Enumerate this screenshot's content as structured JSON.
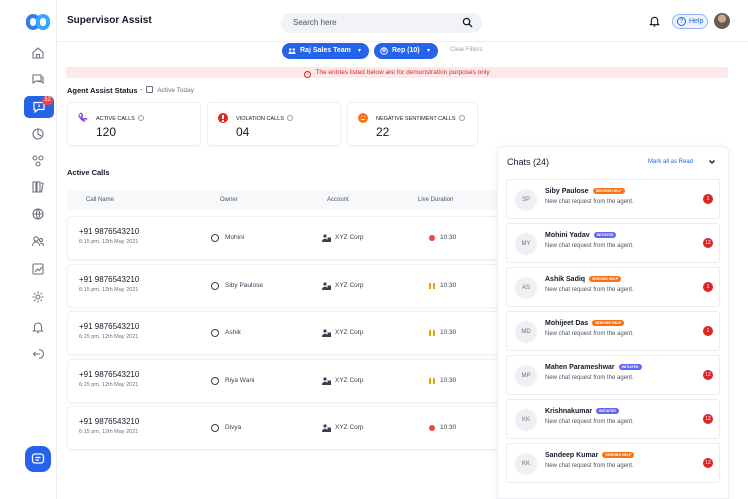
{
  "app": {
    "title": "Supervisor Assist"
  },
  "sidebar": {
    "badge": "32"
  },
  "search": {
    "placeholder": "Search here"
  },
  "header": {
    "help_label": "Help"
  },
  "filters": {
    "team": "Raj Sales Team",
    "rep": "Rep (10)",
    "clear": "Clear Filters"
  },
  "notice": "The entries listed below are for demonstration purposes only",
  "status": {
    "title": "Agent Assist Status",
    "active_today": "Active Today",
    "cards": [
      {
        "label": "ACTIVE CALLS",
        "value": "120",
        "color": "#7c3aed"
      },
      {
        "label": "VIOLATION CALLS",
        "value": "04",
        "color": "#dc2626"
      },
      {
        "label": "NEGATIVE SENTIMENT CALLS",
        "value": "22",
        "color": "#f97316"
      }
    ]
  },
  "active_calls": {
    "title": "Active Calls",
    "columns": [
      "Call Name",
      "Owner",
      "Account",
      "Live Duration"
    ],
    "rows": [
      {
        "number": "+91 9876543210",
        "time": "6:15 pm, 12th May 2021",
        "owner": "Mohini",
        "account": "XYZ Corp",
        "duration": "10:30",
        "state": "live"
      },
      {
        "number": "+91 9876543210",
        "time": "6:15 pm, 12th May 2021",
        "owner": "Siby Paulose",
        "account": "XYZ Corp",
        "duration": "10:30",
        "state": "paused"
      },
      {
        "number": "+91 9876543210",
        "time": "6:15 pm, 12th May 2021",
        "owner": "Ashik",
        "account": "XYZ Corp",
        "duration": "10:30",
        "state": "paused"
      },
      {
        "number": "+91 9876543210",
        "time": "6:15 pm, 12th May 2021",
        "owner": "Riya Wani",
        "account": "XYZ Corp",
        "duration": "10:30",
        "state": "paused"
      },
      {
        "number": "+91 9876543210",
        "time": "6:15 pm, 12th May 2021",
        "owner": "Divya",
        "account": "XYZ Corp",
        "duration": "10:30",
        "state": "live"
      }
    ]
  },
  "chats": {
    "title": "Chats (24)",
    "mark_all_read": "Mark all as Read",
    "items": [
      {
        "initials": "SP",
        "name": "Siby Paulose",
        "tag": "SEEKING HELP",
        "tag_type": "help",
        "message": "New chat request from the agent.",
        "count": "1"
      },
      {
        "initials": "MY",
        "name": "Mohini Yadav",
        "tag": "INITIATED",
        "tag_type": "init",
        "message": "New chat request from the agent.",
        "count": "12"
      },
      {
        "initials": "AS",
        "name": "Ashik Sadiq",
        "tag": "SEEKING HELP",
        "tag_type": "help",
        "message": "New chat request from the agent.",
        "count": "1"
      },
      {
        "initials": "MD",
        "name": "Mohijeet Das",
        "tag": "SEEKING HELP",
        "tag_type": "help",
        "message": "New chat request from the agent.",
        "count": "1"
      },
      {
        "initials": "MP",
        "name": "Mahen Parameshwar",
        "tag": "INITIATED",
        "tag_type": "init",
        "message": "New chat request from the agent.",
        "count": "12"
      },
      {
        "initials": "KK",
        "name": "Krishnakumar",
        "tag": "INITIATED",
        "tag_type": "init",
        "message": "New chat request from the agent.",
        "count": "12"
      },
      {
        "initials": "KK",
        "name": "Sandeep Kumar",
        "tag": "SEEKING HELP",
        "tag_type": "help",
        "message": "New chat request from the agent.",
        "count": "12"
      }
    ]
  }
}
